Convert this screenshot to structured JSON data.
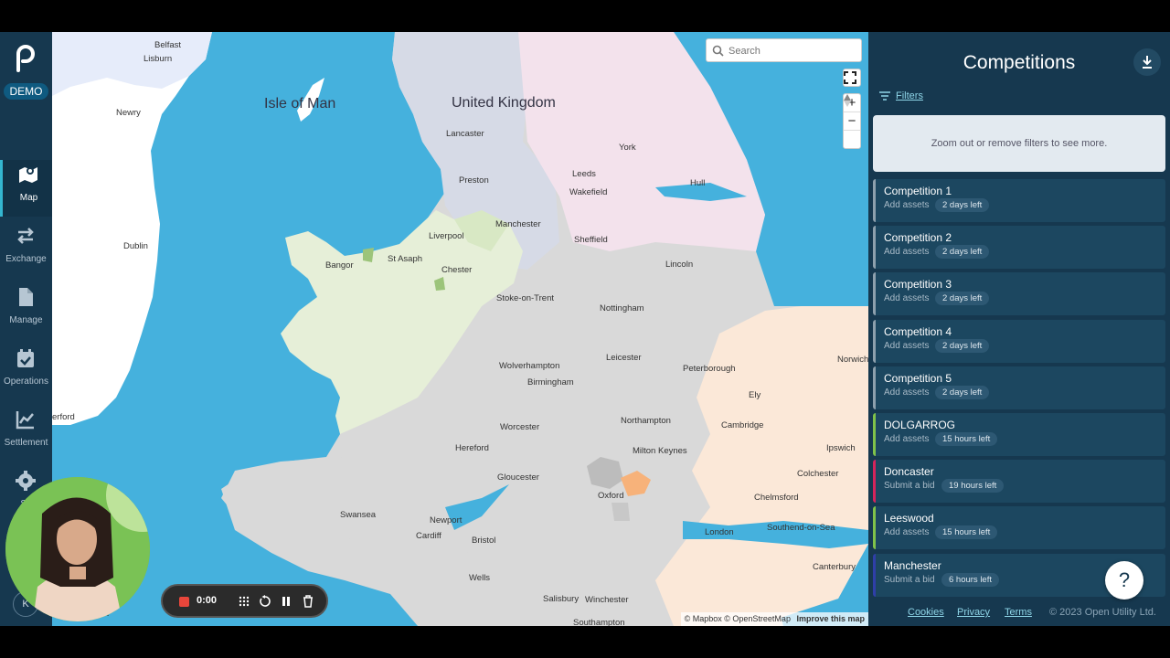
{
  "app": {
    "badge": "DEMO"
  },
  "sidebar": {
    "items": [
      {
        "label": "Map",
        "icon": "map-icon",
        "active": true
      },
      {
        "label": "Exchange",
        "icon": "exchange-icon"
      },
      {
        "label": "Manage",
        "icon": "document-icon"
      },
      {
        "label": "Operations",
        "icon": "calendar-check-icon"
      },
      {
        "label": "Settlement",
        "icon": "chart-line-icon"
      },
      {
        "label": "Se",
        "icon": "gear-icon"
      }
    ],
    "user_initials": "K"
  },
  "map": {
    "search_placeholder": "Search",
    "zoom_in": "+",
    "zoom_out": "−",
    "attribution": "© Mapbox © OpenStreetMap",
    "improve": "Improve this map",
    "labels": {
      "belfast": "Belfast",
      "lisburn": "Lisburn",
      "newry": "Newry",
      "dublin": "Dublin",
      "erford": "erford",
      "isle_of_man": "Isle of Man",
      "united_kingdom": "United Kingdom",
      "lancaster": "Lancaster",
      "preston": "Preston",
      "york": "York",
      "leeds": "Leeds",
      "wakefield": "Wakefield",
      "hull": "Hull",
      "manchester": "Manchester",
      "liverpool": "Liverpool",
      "sheffield": "Sheffield",
      "lincoln": "Lincoln",
      "bangor": "Bangor",
      "st_asaph": "St Asaph",
      "chester": "Chester",
      "stoke": "Stoke-on-Trent",
      "nottingham": "Nottingham",
      "leicester": "Leicester",
      "wolverhampton": "Wolverhampton",
      "birmingham": "Birmingham",
      "peterborough": "Peterborough",
      "norwich": "Norwich",
      "ely": "Ely",
      "cambridge": "Cambridge",
      "worcester": "Worcester",
      "northampton": "Northampton",
      "hereford": "Hereford",
      "milton_keynes": "Milton Keynes",
      "ipswich": "Ipswich",
      "gloucester": "Gloucester",
      "oxford": "Oxford",
      "colchester": "Colchester",
      "chelmsford": "Chelmsford",
      "swansea": "Swansea",
      "newport": "Newport",
      "cardiff": "Cardiff",
      "bristol": "Bristol",
      "london": "London",
      "southend": "Southend-on-Sea",
      "wells": "Wells",
      "salisbury": "Salisbury",
      "winchester": "Winchester",
      "canterbury": "Canterbury",
      "southampton": "Southampton",
      "ox": "ox"
    }
  },
  "recorder": {
    "time": "0:00"
  },
  "panel": {
    "title": "Competitions",
    "filters_label": "Filters",
    "notice": "Zoom out or remove filters to see more.",
    "competitions": [
      {
        "name": "Competition 1",
        "action": "Add assets",
        "time_left": "2 days left",
        "accent": "#8da0ad"
      },
      {
        "name": "Competition 2",
        "action": "Add assets",
        "time_left": "2 days left",
        "accent": "#8da0ad"
      },
      {
        "name": "Competition 3",
        "action": "Add assets",
        "time_left": "2 days left",
        "accent": "#8da0ad"
      },
      {
        "name": "Competition 4",
        "action": "Add assets",
        "time_left": "2 days left",
        "accent": "#8da0ad"
      },
      {
        "name": "Competition 5",
        "action": "Add assets",
        "time_left": "2 days left",
        "accent": "#8da0ad"
      },
      {
        "name": "DOLGARROG",
        "action": "Add assets",
        "time_left": "15 hours left",
        "accent": "#7fc24a"
      },
      {
        "name": "Doncaster",
        "action": "Submit a bid",
        "time_left": "19 hours left",
        "accent": "#d6245c"
      },
      {
        "name": "Leeswood",
        "action": "Add assets",
        "time_left": "15 hours left",
        "accent": "#7fc24a"
      },
      {
        "name": "Manchester",
        "action": "Submit a bid",
        "time_left": "6 hours left",
        "accent": "#2f3fa8"
      }
    ],
    "help": "?",
    "footer": {
      "cookies": "Cookies",
      "privacy": "Privacy",
      "terms": "Terms",
      "copyright": "© 2023 Open Utility Ltd."
    }
  }
}
